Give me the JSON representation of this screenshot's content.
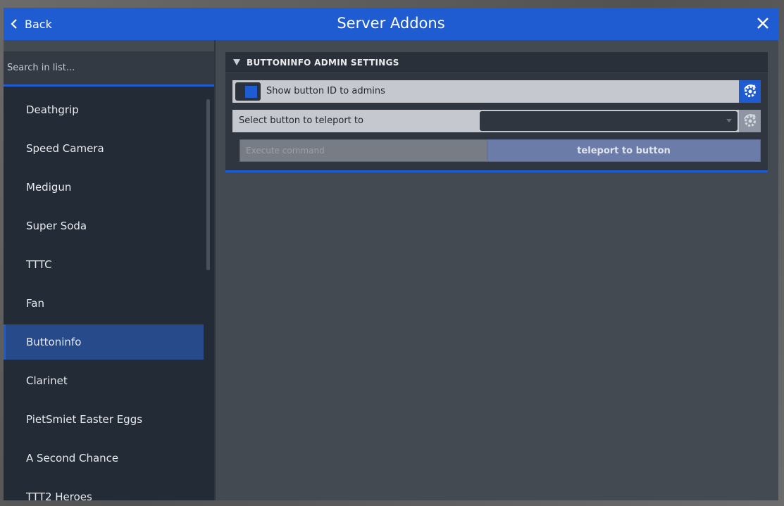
{
  "window": {
    "title": "Server Addons",
    "back_label": "Back"
  },
  "sidebar": {
    "search_placeholder": "Search in list...",
    "items": [
      {
        "label": "Deathgrip"
      },
      {
        "label": "Speed Camera"
      },
      {
        "label": "Medigun"
      },
      {
        "label": "Super Soda"
      },
      {
        "label": "TTTC"
      },
      {
        "label": "Fan"
      },
      {
        "label": "Buttoninfo",
        "active": true
      },
      {
        "label": "Clarinet"
      },
      {
        "label": "PietSmiet Easter Eggs"
      },
      {
        "label": "A Second Chance"
      },
      {
        "label": "TTT2 Heroes"
      }
    ]
  },
  "panel": {
    "header": "BUTTONINFO ADMIN SETTINGS",
    "checkbox": {
      "label": "Show button ID to admins",
      "checked": true
    },
    "select": {
      "label": "Select button to teleport to",
      "value": ""
    },
    "command": {
      "placeholder": "Execute command",
      "button_label": "teleport to button"
    }
  },
  "colors": {
    "accent": "#1f5cd1",
    "sidebar_bg": "#232b36",
    "content_bg": "#444a52",
    "active_item": "#274a8a"
  },
  "icons": {
    "back": "chevron-left-icon",
    "close": "close-icon",
    "collapse": "triangle-down-icon",
    "reset": "reset-gear-icon"
  }
}
